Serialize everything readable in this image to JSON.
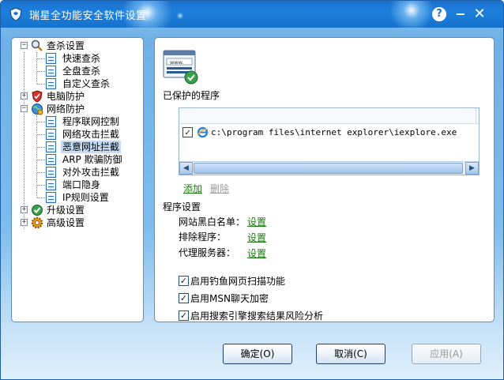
{
  "window": {
    "title": "瑞星全功能安全软件设置",
    "help_label": "?",
    "minimize_label": "−",
    "close_label": "✕"
  },
  "tree": {
    "items": [
      {
        "label": "查杀设置",
        "icon": "magnifier-icon"
      },
      {
        "label": "快速查杀",
        "icon": "document-icon"
      },
      {
        "label": "全盘查杀",
        "icon": "document-icon"
      },
      {
        "label": "自定义查杀",
        "icon": "document-icon"
      },
      {
        "label": "电脑防护",
        "icon": "shield-icon"
      },
      {
        "label": "网络防护",
        "icon": "globe-icon"
      },
      {
        "label": "程序联网控制",
        "icon": "document-icon"
      },
      {
        "label": "网络攻击拦截",
        "icon": "document-icon"
      },
      {
        "label": "恶意网址拦截",
        "icon": "document-icon",
        "selected": true
      },
      {
        "label": "ARP 欺骗防御",
        "icon": "document-icon"
      },
      {
        "label": "对外攻击拦截",
        "icon": "document-icon"
      },
      {
        "label": "端口隐身",
        "icon": "document-icon"
      },
      {
        "label": "IP规则设置",
        "icon": "document-icon"
      },
      {
        "label": "升级设置",
        "icon": "check-globe-icon"
      },
      {
        "label": "高级设置",
        "icon": "gear-icon"
      }
    ]
  },
  "main": {
    "protected_title": "已保护的程序",
    "programs": [
      {
        "checked": true,
        "path": "c:\\program files\\internet explorer\\iexplore.exe"
      }
    ],
    "add_label": "添加",
    "delete_label": "删除",
    "program_settings_title": "程序设置",
    "settings": [
      {
        "label": "网站黑白名单：",
        "link": "设置"
      },
      {
        "label": "排除程序：",
        "link": "设置"
      },
      {
        "label": "代理服务器：",
        "link": "设置"
      }
    ],
    "options": [
      {
        "checked": true,
        "label": "启用钓鱼网页扫描功能"
      },
      {
        "checked": true,
        "label": "启用MSN聊天加密"
      },
      {
        "checked": true,
        "label": "启用搜索引擎搜索结果风险分析"
      }
    ],
    "browser_icon_text": "www."
  },
  "buttons": {
    "ok": "确定(O)",
    "cancel": "取消(C)",
    "apply": "应用(A)"
  },
  "colors": {
    "title_bar": "#1a6fce",
    "link_green": "#1c7a12",
    "selection": "#c5dcf5"
  }
}
